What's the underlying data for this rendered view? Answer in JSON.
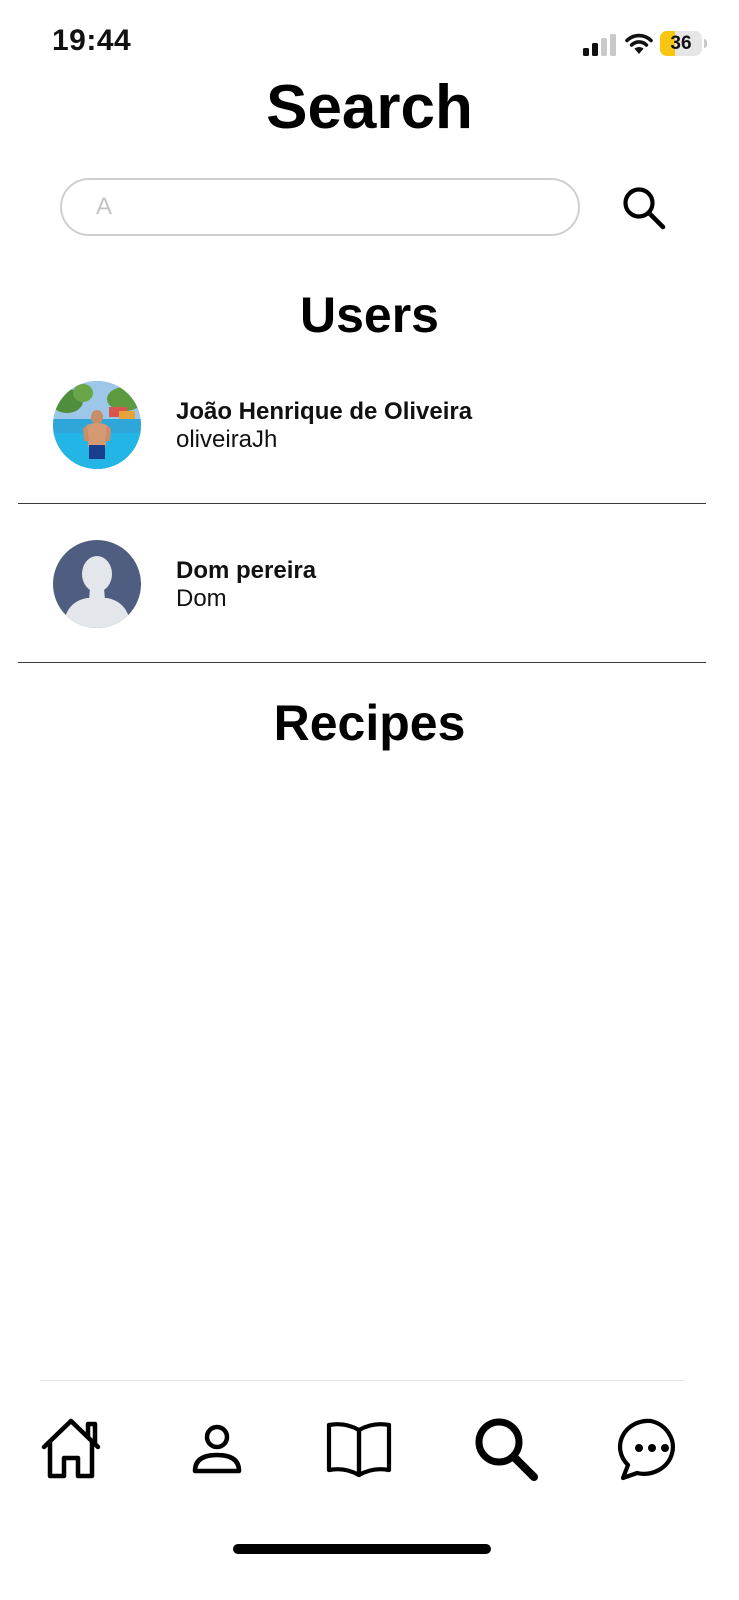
{
  "status_bar": {
    "time": "19:44",
    "battery_level": "36",
    "battery_fraction": 0.36,
    "battery_color": "#f7c611",
    "signal_icon": "cellular-signal-icon",
    "wifi_icon": "wifi-icon"
  },
  "header": {
    "title": "Search"
  },
  "search": {
    "value": "",
    "placeholder": "A",
    "button_icon": "search-icon"
  },
  "users": {
    "heading": "Users",
    "items": [
      {
        "name": "João Henrique de Oliveira",
        "username": "oliveiraJh",
        "avatar": "photo-avatar"
      },
      {
        "name": "Dom pereira",
        "username": "Dom",
        "avatar": "default-avatar-icon"
      }
    ]
  },
  "recipes": {
    "heading": "Recipes",
    "items": []
  },
  "bottom_nav": {
    "items": [
      {
        "icon": "home-icon"
      },
      {
        "icon": "profile-icon"
      },
      {
        "icon": "book-icon"
      },
      {
        "icon": "search-icon",
        "active": true
      },
      {
        "icon": "chat-icon"
      }
    ]
  }
}
